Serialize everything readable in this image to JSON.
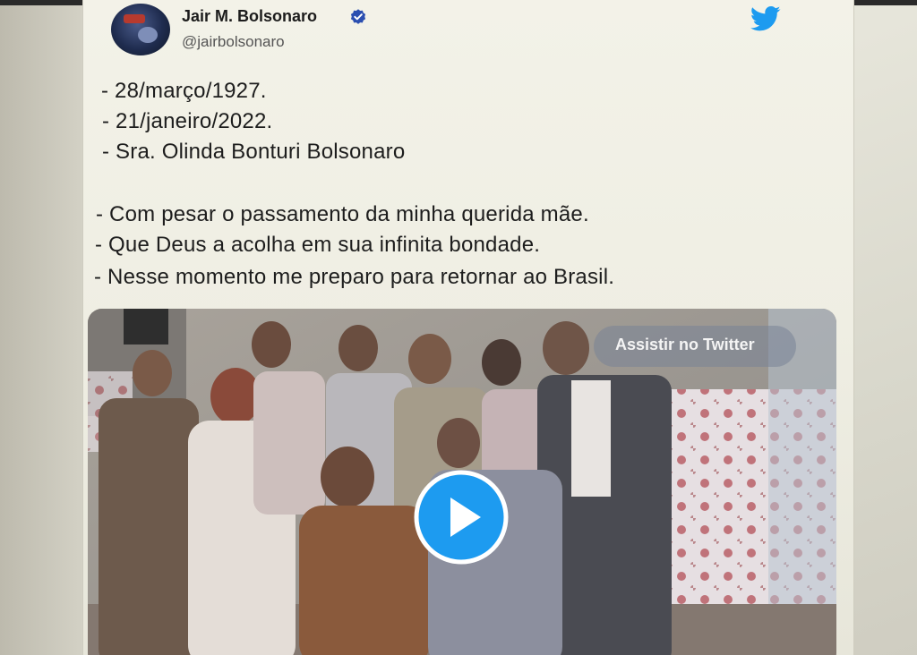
{
  "author": {
    "name": "Jair M. Bolsonaro",
    "handle": "@jairbolsonaro",
    "verified_icon": "verified-badge-icon",
    "platform_icon": "twitter-bird-icon"
  },
  "tweet": {
    "lines": [
      "- 28/março/1927.",
      "- 21/janeiro/2022.",
      "- Sra. Olinda Bonturi Bolsonaro",
      "- Com pesar o passamento da minha querida mãe.",
      "- Que Deus a acolha em sua infinita bondade.",
      "- Nesse momento me preparo para retornar ao Brasil."
    ]
  },
  "media": {
    "watch_label": "Assistir no Twitter",
    "play_icon": "play-icon"
  },
  "colors": {
    "twitter_blue": "#1d9bf0",
    "verified_blue": "#2b59c3"
  }
}
